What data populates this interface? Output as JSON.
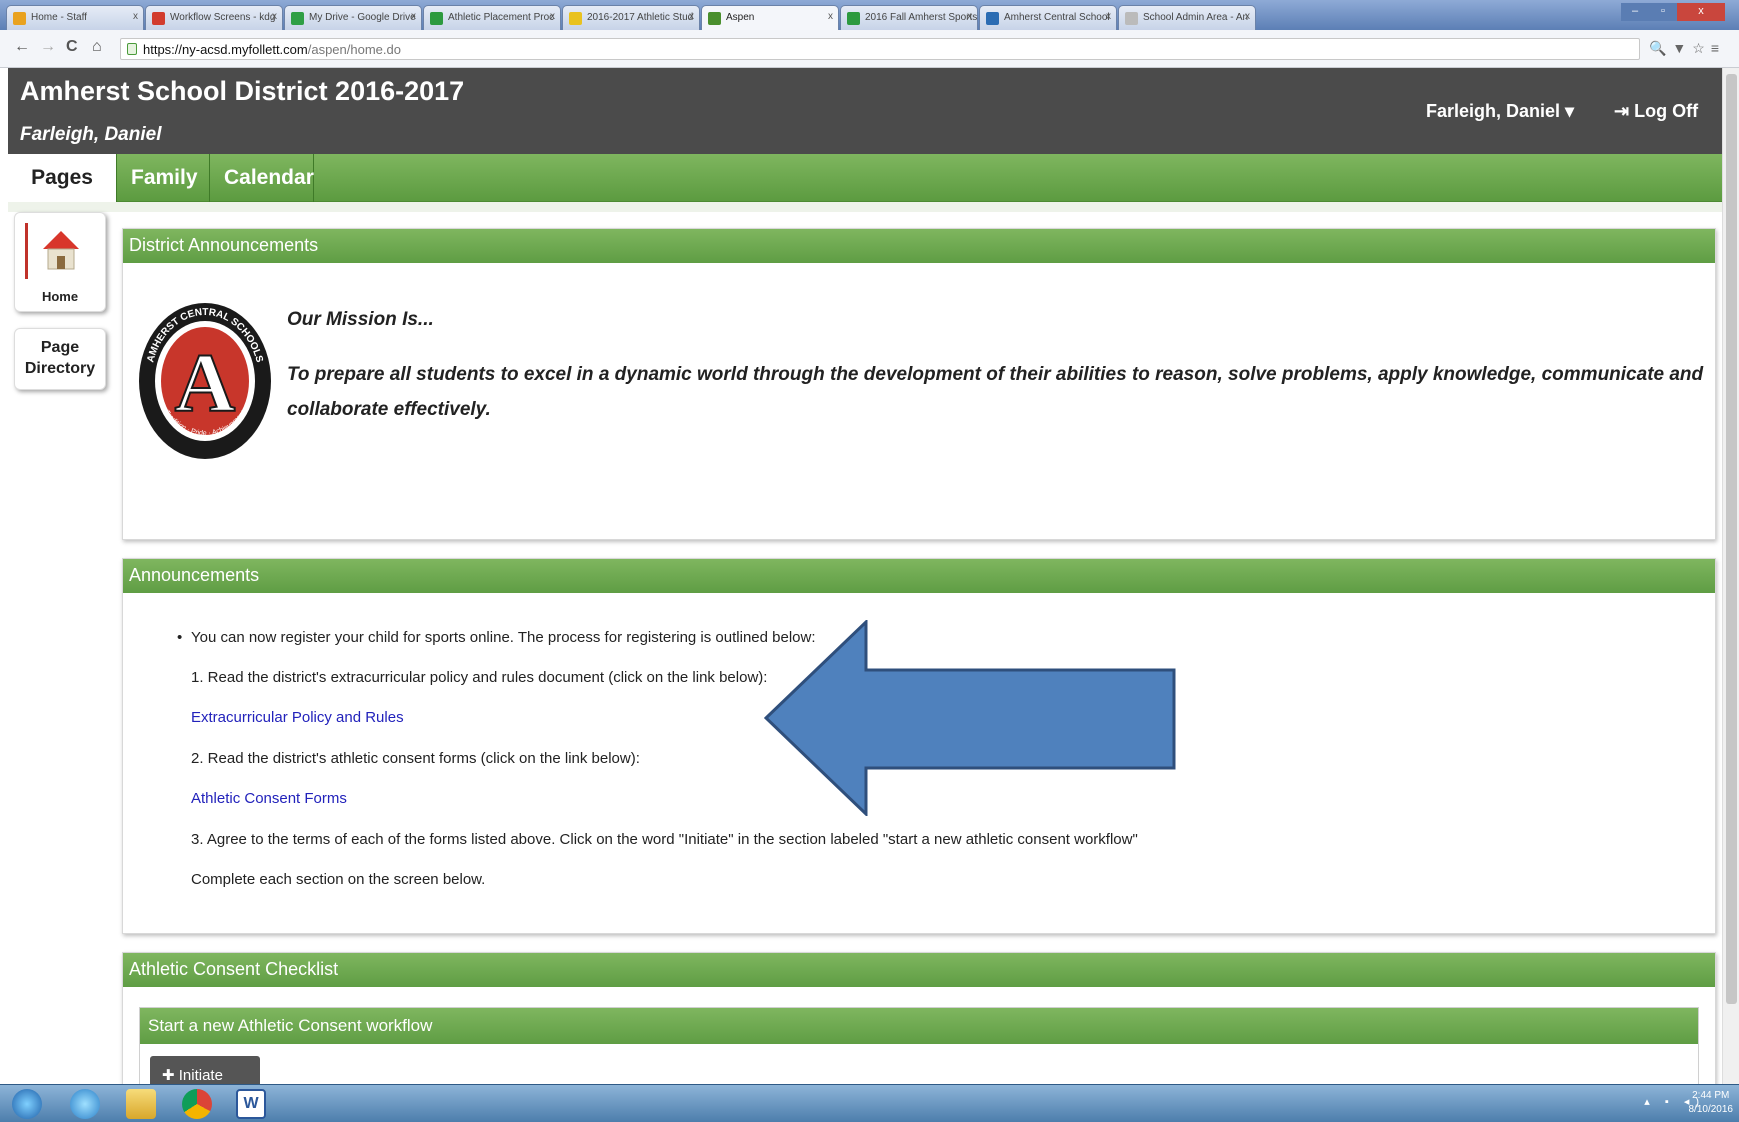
{
  "browser": {
    "tabs": [
      {
        "label": "Home - Staff",
        "fav": "#e9a21f",
        "active": false
      },
      {
        "label": "Workflow Screens - kdg",
        "fav": "#d23c2e",
        "active": false
      },
      {
        "label": "My Drive - Google Drive",
        "fav": "#2f9f45",
        "active": false
      },
      {
        "label": "Athletic Placement Proc",
        "fav": "#2d9a3f",
        "active": false
      },
      {
        "label": "2016-2017 Athletic Stud",
        "fav": "#e9c21f",
        "active": false
      },
      {
        "label": "Aspen",
        "fav": "#4a8f2e",
        "active": true
      },
      {
        "label": "2016 Fall Amherst Sports",
        "fav": "#2d9a3f",
        "active": false
      },
      {
        "label": "Amherst Central School",
        "fav": "#2b6cb3",
        "active": false
      },
      {
        "label": "School Admin Area - An",
        "fav": "#bbbbbb",
        "active": false
      }
    ],
    "tab_close": "x",
    "url_host": "https://ny-acsd.myfollett.com",
    "url_path": "/aspen/home.do",
    "nav_back": "←",
    "nav_forward": "→",
    "nav_reload": "C",
    "nav_home": "⌂",
    "right_icons": "🔍▼☆≡"
  },
  "header": {
    "title": "Amherst School District 2016-2017",
    "user": "Farleigh, Daniel",
    "user_menu": "Farleigh, Daniel ▾",
    "logoff": "⇥ Log Off"
  },
  "nav": {
    "tabs": [
      "Pages",
      "Family",
      "Calendar"
    ]
  },
  "sidebar": {
    "home_label": "Home",
    "directory_label": "Page Directory"
  },
  "district_announcements": {
    "heading": "District Announcements",
    "mission_title": "Our Mission Is...",
    "mission_text": "To prepare all students to excel in a dynamic world through the development of their abilities to reason, solve problems, apply knowledge, communicate and collaborate effectively.",
    "seal_top": "AMHERST CENTRAL SCHOOLS",
    "seal_letter": "A",
    "seal_bottom": "Tradition · Pride · Achievement"
  },
  "announcements": {
    "heading": "Announcements",
    "bullet": "•",
    "line1": "You can now register your child for sports online. The process for registering is outlined below:",
    "line2": "1. Read the district's extracurricular policy and rules document (click on the link below):",
    "link1": "Extracurricular Policy and Rules",
    "line3": "2. Read the district's athletic consent forms (click on the link below):",
    "link2": "Athletic Consent Forms",
    "line4": "3. Agree to the terms of each of the forms listed above. Click on the word \"Initiate\" in the section labeled \"start a new athletic consent workflow\"",
    "line5": "Complete each section on the screen below."
  },
  "athletic": {
    "heading": "Athletic Consent Checklist",
    "subheading": "Start a new Athletic Consent workflow",
    "initiate": "✚ Initiate"
  },
  "taskbar": {
    "clock_time": "2:44 PM",
    "clock_date": "8/10/2016"
  },
  "colors": {
    "header_bg": "#4b4b4b",
    "green": "#6aa84f",
    "link": "#2222bb",
    "arrow": "#4f81bd"
  }
}
